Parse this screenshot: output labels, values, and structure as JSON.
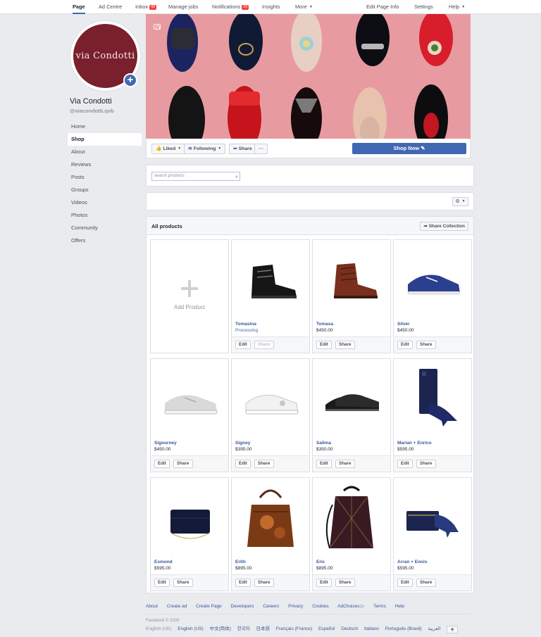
{
  "topnav": {
    "items": [
      {
        "label": "Page",
        "active": true
      },
      {
        "label": "Ad Centre"
      },
      {
        "label": "Inbox",
        "badge": "42"
      },
      {
        "label": "Manage jobs"
      },
      {
        "label": "Notifications",
        "badge": "20"
      },
      {
        "label": "Insights"
      },
      {
        "label": "More"
      }
    ],
    "right": [
      "Edit Page Info",
      "Settings",
      "Help"
    ]
  },
  "profile": {
    "logo_text": "via Condotti",
    "name": "Via Condotti",
    "handle": "@viacondotti.qvb"
  },
  "leftnav": [
    "Home",
    "Shop",
    "About",
    "Reviews",
    "Posts",
    "Groups",
    "Videos",
    "Photos",
    "Community",
    "Offers"
  ],
  "leftnav_active": "Shop",
  "actions": {
    "liked": "Liked",
    "following": "Following",
    "share": "Share",
    "more": "···",
    "shop_now": "Shop Now"
  },
  "search": {
    "placeholder": "search products"
  },
  "products_panel": {
    "title": "All products",
    "share_collection": "Share Collection",
    "add_product": "Add Product"
  },
  "products": [
    {
      "name": "Tomasina",
      "price": "Processing",
      "processing": true,
      "img": "boot-black",
      "share_disabled": true
    },
    {
      "name": "Tomasa",
      "price": "$450.00",
      "img": "boot-brown"
    },
    {
      "name": "Silver",
      "price": "$450.00",
      "img": "sneaker-blue"
    },
    {
      "name": "Sigourney",
      "price": "$450.00",
      "img": "sneaker-silver"
    },
    {
      "name": "Signey",
      "price": "$395.00",
      "img": "sneaker-white"
    },
    {
      "name": "Salima",
      "price": "$350.00",
      "img": "oxford-black"
    },
    {
      "name": "Marian + Enrico",
      "price": "$595.00",
      "img": "navy-set"
    },
    {
      "name": "Esmond",
      "price": "$595.00",
      "img": "clutch-navy"
    },
    {
      "name": "Erith",
      "price": "$895.00",
      "img": "handbag-brown"
    },
    {
      "name": "Eric",
      "price": "$895.00",
      "img": "backpack"
    },
    {
      "name": "Arran + Ennis",
      "price": "$595.00",
      "img": "navy-heel-clutch"
    }
  ],
  "card_buttons": {
    "edit": "Edit",
    "share": "Share"
  },
  "footer": {
    "links": [
      "About",
      "Create ad",
      "Create Page",
      "Developers",
      "Careers",
      "Privacy",
      "Cookies",
      "AdChoices ▷",
      "Terms",
      "Help"
    ],
    "copyright": "Facebook © 2020",
    "current_lang": "English (UK)",
    "languages": [
      "English (US)",
      "中文(简体)",
      "한국어",
      "日本語",
      "Français (France)",
      "Español",
      "Deutsch",
      "Italiano",
      "Português (Brasil)",
      "العربية"
    ],
    "lang_plus": "+"
  },
  "colors": {
    "brand_blue": "#4267b2",
    "cover_pink": "#e79ba0",
    "logo_maroon": "#7a1f2c"
  }
}
